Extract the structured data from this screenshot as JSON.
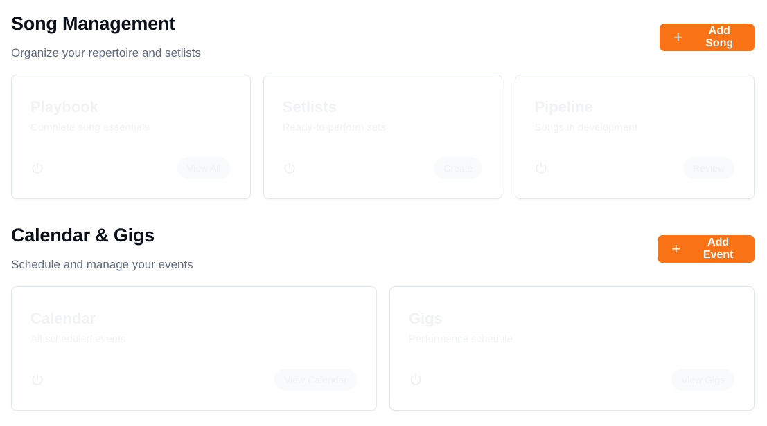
{
  "song_management": {
    "title": "Song Management",
    "subtitle": "Organize your repertoire and setlists",
    "add_label": "Add Song",
    "cards": [
      {
        "title": "Playbook",
        "description": "Complete song essentials",
        "pill": "View All"
      },
      {
        "title": "Setlists",
        "description": "Ready-to-perform sets",
        "pill": "Create"
      },
      {
        "title": "Pipeline",
        "description": "Songs in development",
        "pill": "Review"
      }
    ]
  },
  "calendar_gigs": {
    "title": "Calendar & Gigs",
    "subtitle": "Schedule and manage your events",
    "add_label": "Add Event",
    "cards": [
      {
        "title": "Calendar",
        "description": "All scheduled events",
        "pill": "View Calendar"
      },
      {
        "title": "Gigs",
        "description": "Performance schedule",
        "pill": "View Gigs"
      }
    ]
  },
  "colors": {
    "accent": "#f97316",
    "title": "#0b0f1a",
    "subtitle": "#5f6b7d",
    "card_border": "#e3e6eb"
  },
  "icons": {
    "add_button": "plus-icon",
    "card": "power-icon"
  }
}
